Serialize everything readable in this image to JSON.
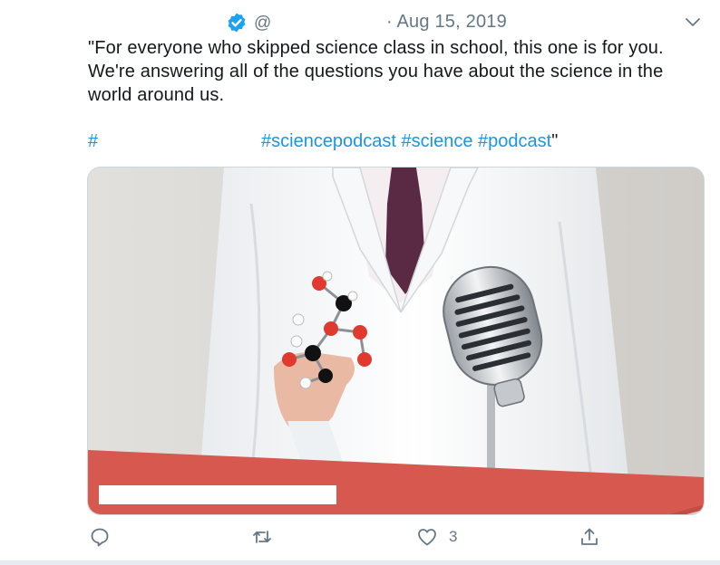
{
  "header": {
    "handle": "@",
    "date": "· Aug 15, 2019",
    "icons": {
      "verified": "verified-badge-icon",
      "menu": "chevron-down-icon"
    }
  },
  "tweet": {
    "text": "\"For everyone who skipped science class in school, this one is for you. We're answering all of the questions you have about the science in the world around us.",
    "hash_lone": "#",
    "hashtags": [
      "#sciencepodcast",
      "#science",
      "#podcast"
    ],
    "closing_quote": "\""
  },
  "actions": {
    "reply": {
      "icon": "reply-icon"
    },
    "retweet": {
      "icon": "retweet-icon"
    },
    "like": {
      "icon": "heart-icon",
      "count": "3"
    },
    "share": {
      "icon": "share-icon"
    }
  },
  "colors": {
    "link": "#1b95e0",
    "muted": "#657786",
    "verified": "#1da1f2",
    "banner_red": "#d6584f"
  }
}
